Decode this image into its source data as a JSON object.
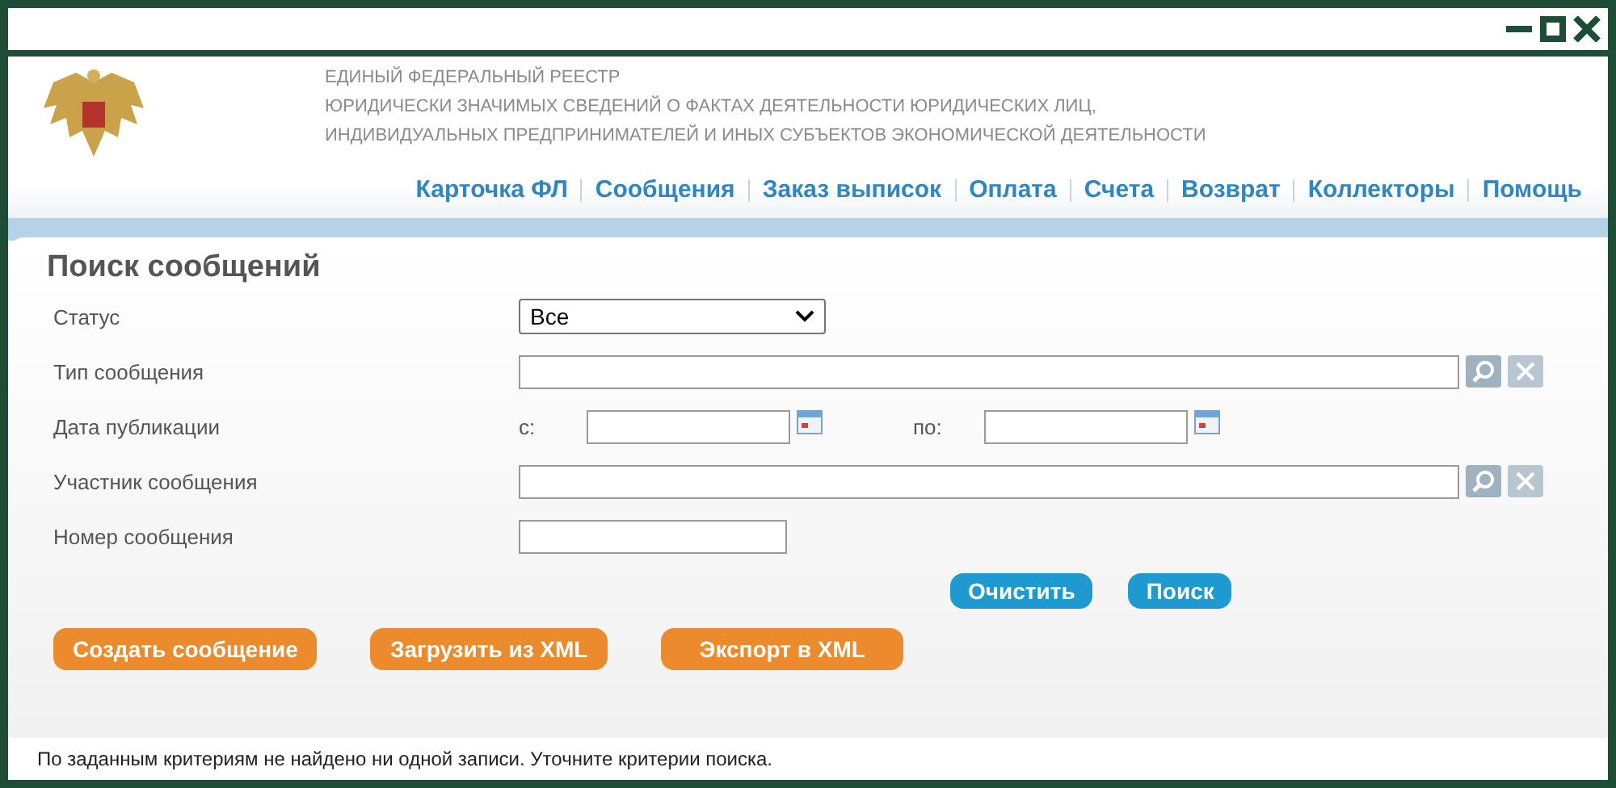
{
  "header": {
    "lines": [
      "ЕДИНЫЙ ФЕДЕРАЛЬНЫЙ РЕЕСТР",
      "ЮРИДИЧЕСКИ ЗНАЧИМЫХ СВЕДЕНИЙ О ФАКТАХ ДЕЯТЕЛЬНОСТИ ЮРИДИЧЕСКИХ ЛИЦ,",
      "ИНДИВИДУАЛЬНЫХ ПРЕДПРИНИМАТЕЛЕЙ И ИНЫХ СУБЪЕКТОВ ЭКОНОМИЧЕСКОЙ ДЕЯТЕЛЬНОСТИ"
    ]
  },
  "nav": [
    {
      "label": "Карточка ФЛ"
    },
    {
      "label": "Сообщения"
    },
    {
      "label": "Заказ выписок"
    },
    {
      "label": "Оплата"
    },
    {
      "label": "Счета"
    },
    {
      "label": "Возврат"
    },
    {
      "label": "Коллекторы"
    },
    {
      "label": "Помощь"
    }
  ],
  "form": {
    "title": "Поиск сообщений",
    "fields": [
      {
        "kind": "select",
        "label": "Статус",
        "value": "Все"
      },
      {
        "kind": "lookup",
        "label": "Тип сообщения"
      },
      {
        "kind": "date_range",
        "label": "Дата публикации",
        "from_label": "с:",
        "to_label": "по:"
      },
      {
        "kind": "lookup",
        "label": "Участник сообщения"
      },
      {
        "kind": "text",
        "label": "Номер сообщения"
      }
    ],
    "search_buttons": [
      "Очистить",
      "Поиск"
    ],
    "action_buttons": [
      "Создать сообщение",
      "Загрузить из XML",
      "Экспорт в XML"
    ]
  },
  "message": "По заданным критериям не найдено ни одной записи. Уточните критерии поиска."
}
